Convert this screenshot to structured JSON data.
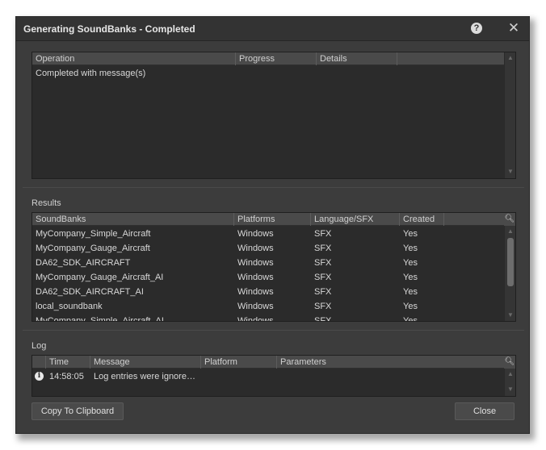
{
  "window": {
    "title": "Generating SoundBanks - Completed",
    "help_icon": "?",
    "close_icon": "✕"
  },
  "operations": {
    "columns": [
      "Operation",
      "Progress",
      "Details"
    ],
    "rows": [
      {
        "operation": "Completed with message(s)",
        "progress": "",
        "details": ""
      }
    ]
  },
  "results": {
    "label": "Results",
    "columns": [
      "SoundBanks",
      "Platforms",
      "Language/SFX",
      "Created"
    ],
    "rows": [
      {
        "soundbank": "MyCompany_Simple_Aircraft",
        "platform": "Windows",
        "language": "SFX",
        "created": "Yes"
      },
      {
        "soundbank": "MyCompany_Gauge_Aircraft",
        "platform": "Windows",
        "language": "SFX",
        "created": "Yes"
      },
      {
        "soundbank": "DA62_SDK_AIRCRAFT",
        "platform": "Windows",
        "language": "SFX",
        "created": "Yes"
      },
      {
        "soundbank": "MyCompany_Gauge_Aircraft_AI",
        "platform": "Windows",
        "language": "SFX",
        "created": "Yes"
      },
      {
        "soundbank": "DA62_SDK_AIRCRAFT_AI",
        "platform": "Windows",
        "language": "SFX",
        "created": "Yes"
      },
      {
        "soundbank": "local_soundbank",
        "platform": "Windows",
        "language": "SFX",
        "created": "Yes"
      },
      {
        "soundbank": "MyCompany_Simple_Aircraft_AI",
        "platform": "Windows",
        "language": "SFX",
        "created": "Yes"
      }
    ]
  },
  "log": {
    "label": "Log",
    "columns": [
      "Time",
      "Message",
      "Platform",
      "Parameters"
    ],
    "rows": [
      {
        "icon": "info-icon",
        "time": "14:58:05",
        "message": "Log entries were ignore…",
        "platform": "",
        "parameters": ""
      }
    ]
  },
  "buttons": {
    "copy": "Copy To Clipboard",
    "close": "Close"
  }
}
